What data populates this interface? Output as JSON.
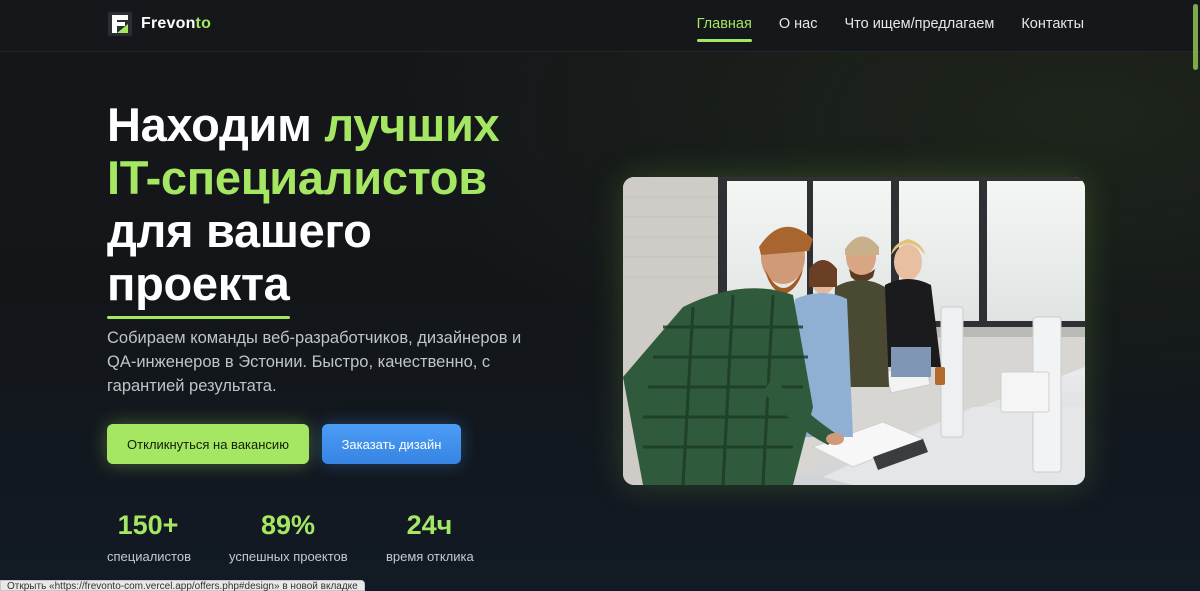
{
  "header": {
    "logo_text_main": "Frevon",
    "logo_text_accent": "to",
    "nav": [
      {
        "label": "Главная",
        "active": true
      },
      {
        "label": "О нас",
        "active": false
      },
      {
        "label": "Что ищем/предлагаем",
        "active": false
      },
      {
        "label": "Контакты",
        "active": false
      }
    ]
  },
  "hero": {
    "title_part1": "Находим",
    "title_part2": "лучших",
    "title_line2": "IT-специалистов",
    "title_line3": "для вашего",
    "title_line4": "проекта",
    "subtitle": "Собираем команды веб-разработчиков, дизайнеров и QA-инженеров в Эстонии. Быстро, качественно, с гарантией результата.",
    "primary_button": "Откликнуться на вакансию",
    "secondary_button": "Заказать дизайн",
    "stats": [
      {
        "value": "150+",
        "label": "специалистов"
      },
      {
        "value": "89%",
        "label": "успешных проектов"
      },
      {
        "value": "24ч",
        "label": "время отклика"
      }
    ]
  },
  "statusbar": {
    "text": "Открыть «https://frevonto-com.vercel.app/offers.php#design» в новой вкладке"
  },
  "colors": {
    "accent_green": "#a5e663",
    "accent_blue": "#3f8ef0",
    "background": "#131619"
  }
}
